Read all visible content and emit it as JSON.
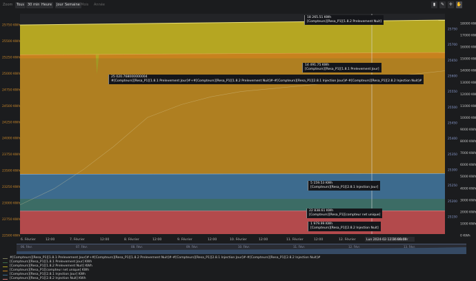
{
  "toolbar": {
    "zoom_label": "Zoom",
    "zoom_buttons": [
      {
        "label": "Tous",
        "enabled": true
      },
      {
        "label": "30 min",
        "enabled": true
      },
      {
        "label": "Heure",
        "enabled": true
      },
      {
        "label": "Jour",
        "enabled": true
      },
      {
        "label": "Semaine",
        "enabled": true
      },
      {
        "label": "Mois",
        "enabled": false
      },
      {
        "label": "Année",
        "enabled": false
      }
    ],
    "tools": [
      {
        "name": "info-icon",
        "glyph": "▮"
      },
      {
        "name": "pencil-icon",
        "glyph": "✎"
      },
      {
        "name": "crosshair-icon",
        "glyph": "✛"
      },
      {
        "name": "hand-icon",
        "glyph": "✋"
      }
    ]
  },
  "colors": {
    "background": "#1b1c1e",
    "yellow": "#b5a622",
    "orange": "#c8821e",
    "blue": "#3d6b8e",
    "green": "#3c6d4a",
    "red": "#b34a4c",
    "rose": "#d67a7a",
    "left_axis_text": "#c9872a",
    "right_axis_text": "#8899cc"
  },
  "chart_data": {
    "type": "area",
    "left_axis": {
      "range": [
        22500,
        25900
      ],
      "ticks": [
        "25750 KWh",
        "25500 KWh",
        "25250 KWh",
        "25000 KWh",
        "24750 KWh",
        "24500 KWh",
        "24250 KWh",
        "24000 KWh",
        "23750 KWh",
        "23500 KWh",
        "23250 KWh",
        "23000 KWh",
        "22750 KWh",
        "22500 KWh"
      ]
    },
    "right_axis_outer": {
      "range": [
        0,
        18800
      ],
      "ticks": [
        "18000 KWh",
        "17000 KWh",
        "16000 KWh",
        "15000 KWh",
        "14000 KWh",
        "13000 KWh",
        "12000 KWh",
        "11000 KWh",
        "10000 KWh",
        "9000 KWh",
        "8000 KWh",
        "7000 KWh",
        "6000 KWh",
        "5000 KWh",
        "4000 KWh",
        "3000 KWh",
        "2000 KWh",
        "1000 KWh",
        "0 KWh"
      ]
    },
    "right_axis_inner": {
      "ticks": [
        "25750",
        "25700",
        "25650",
        "25600",
        "25550",
        "25500",
        "25450",
        "25400",
        "25350",
        "25300",
        "25250",
        "25200",
        "25150"
      ]
    },
    "x_ticks": [
      "6. Février",
      "12:00",
      "7. Février",
      "12:00",
      "8. Février",
      "12:00",
      "9. Février",
      "12:00",
      "10. Février",
      "12:00",
      "11. Février",
      "12:00",
      "12. Février",
      "Lun 2024-02-12 16:00:00",
      "13. Février"
    ],
    "navigator_ticks": [
      "06. Févr.",
      "07. Févr.",
      "08. Févr.",
      "09. Févr.",
      "10. Févr.",
      "11. Févr.",
      "12. Févr.",
      "13. Févr."
    ],
    "series": [
      {
        "name": "#[Compteurs][Resa_P1][1.8.1 Prelevement Jour]#+#[Compteurs][Resa_P1][1.8.2 Prelevement Nuit]#-#[Compteurs][Resa_P1][2.8.1 Injection Jour]#-#[Compteurs][Resa_P1][2.8.2 Injection Nuit]#",
        "color": "#7a7a5a",
        "x_frac": [
          0,
          0.08,
          0.15,
          0.22,
          0.3,
          0.38,
          0.45,
          0.52,
          0.6,
          0.68,
          0.75,
          0.82,
          0.9,
          1
        ],
        "values": [
          22950,
          23200,
          23500,
          23850,
          24300,
          24500,
          24620,
          24700,
          24750,
          24800,
          24850,
          24900,
          24950,
          25020
        ]
      },
      {
        "name": "[Compteurs][Resa_P1][1.8.1 Prelevement Jour] KWh",
        "color": "#3c6d4a"
      },
      {
        "name": "[Compteurs][Resa_P1][1.8.2 Prelevement Nuit] KWh",
        "color": "#b5a622",
        "x_frac": [
          0,
          1
        ],
        "values": [
          17850,
          18265.51
        ]
      },
      {
        "name": "[Compteurs][Resa_P1][compteur net unique] KWh",
        "color": "#c8821e",
        "x_frac": [
          0,
          1
        ],
        "values": [
          15300,
          15500
        ]
      },
      {
        "name": "[Compteurs][Resa_P1][2.8.1 Injection Jour] KWh",
        "color": "#3d6b8e",
        "x_frac": [
          0,
          1
        ],
        "values": [
          5100,
          5159.53
        ]
      },
      {
        "name": "[Compteurs][Resa_P1][2.8.2 Injection Nuit] KWh",
        "color": "#d67a7a",
        "x_frac": [
          0,
          1
        ],
        "values": [
          1960,
          1979.99
        ]
      }
    ],
    "legend_placement": "bottom"
  },
  "tooltips": [
    {
      "id": "tt-prelev-nuit",
      "value": "18 265.51 KWh",
      "label": "[Compteurs][Resa_P1][1.8.2 Prelevement Nuit]"
    },
    {
      "id": "tt-prelev-jour",
      "value": "14 491.75 KWh",
      "label": "[Compteurs][Resa_P1][1.8.1 Prelevement Jour]"
    },
    {
      "id": "tt-formula",
      "value": "25 020.768000000004",
      "label": "#[Compteurs][Resa_P1][1.8.1 Prelevement Jour]#+#[Compteurs][Resa_P1][1.8.2 Prelevement Nuit]#-#[Compteurs][Resa_P1][2.8.1 Injection Jour]#-#[Compteurs][Resa_P1][2.8.2 Injection Nuit]#"
    },
    {
      "id": "tt-inj-jour",
      "value": "5 159.53 KWh",
      "label": "[Compteurs][Resa_P1][2.8.1 Injection Jour]"
    },
    {
      "id": "tt-net",
      "value": "22 838.61 KWh",
      "label": "[Compteurs][Resa_P1][compteur net unique]"
    },
    {
      "id": "tt-inj-nuit",
      "value": "1 979.99 KWh",
      "label": "[Compteurs][Resa_P1][2.8.2 Injection Nuit]"
    }
  ],
  "legend": [
    {
      "label": "#[Compteurs][Resa_P1][1.8.1 Prelevement Jour]#+#[Compteurs][Resa_P1][1.8.2 Prelevement Nuit]#-#[Compteurs][Resa_P1][2.8.1 Injection Jour]#-#[Compteurs][Resa_P1][2.8.2 Injection Nuit]#",
      "color": "#7a7a5a"
    },
    {
      "label": "[Compteurs][Resa_P1][1.8.1 Prelevement Jour] KWh",
      "color": "#3c6d4a"
    },
    {
      "label": "[Compteurs][Resa_P1][1.8.2 Prelevement Nuit] KWh",
      "color": "#b5a622"
    },
    {
      "label": "[Compteurs][Resa_P1][compteur net unique] KWh",
      "color": "#c8821e"
    },
    {
      "label": "[Compteurs][Resa_P1][2.8.1 Injection Jour] KWh",
      "color": "#3d6b8e"
    },
    {
      "label": "[Compteurs][Resa_P1][2.8.2 Injection Nuit] KWh",
      "color": "#d67a7a"
    }
  ]
}
